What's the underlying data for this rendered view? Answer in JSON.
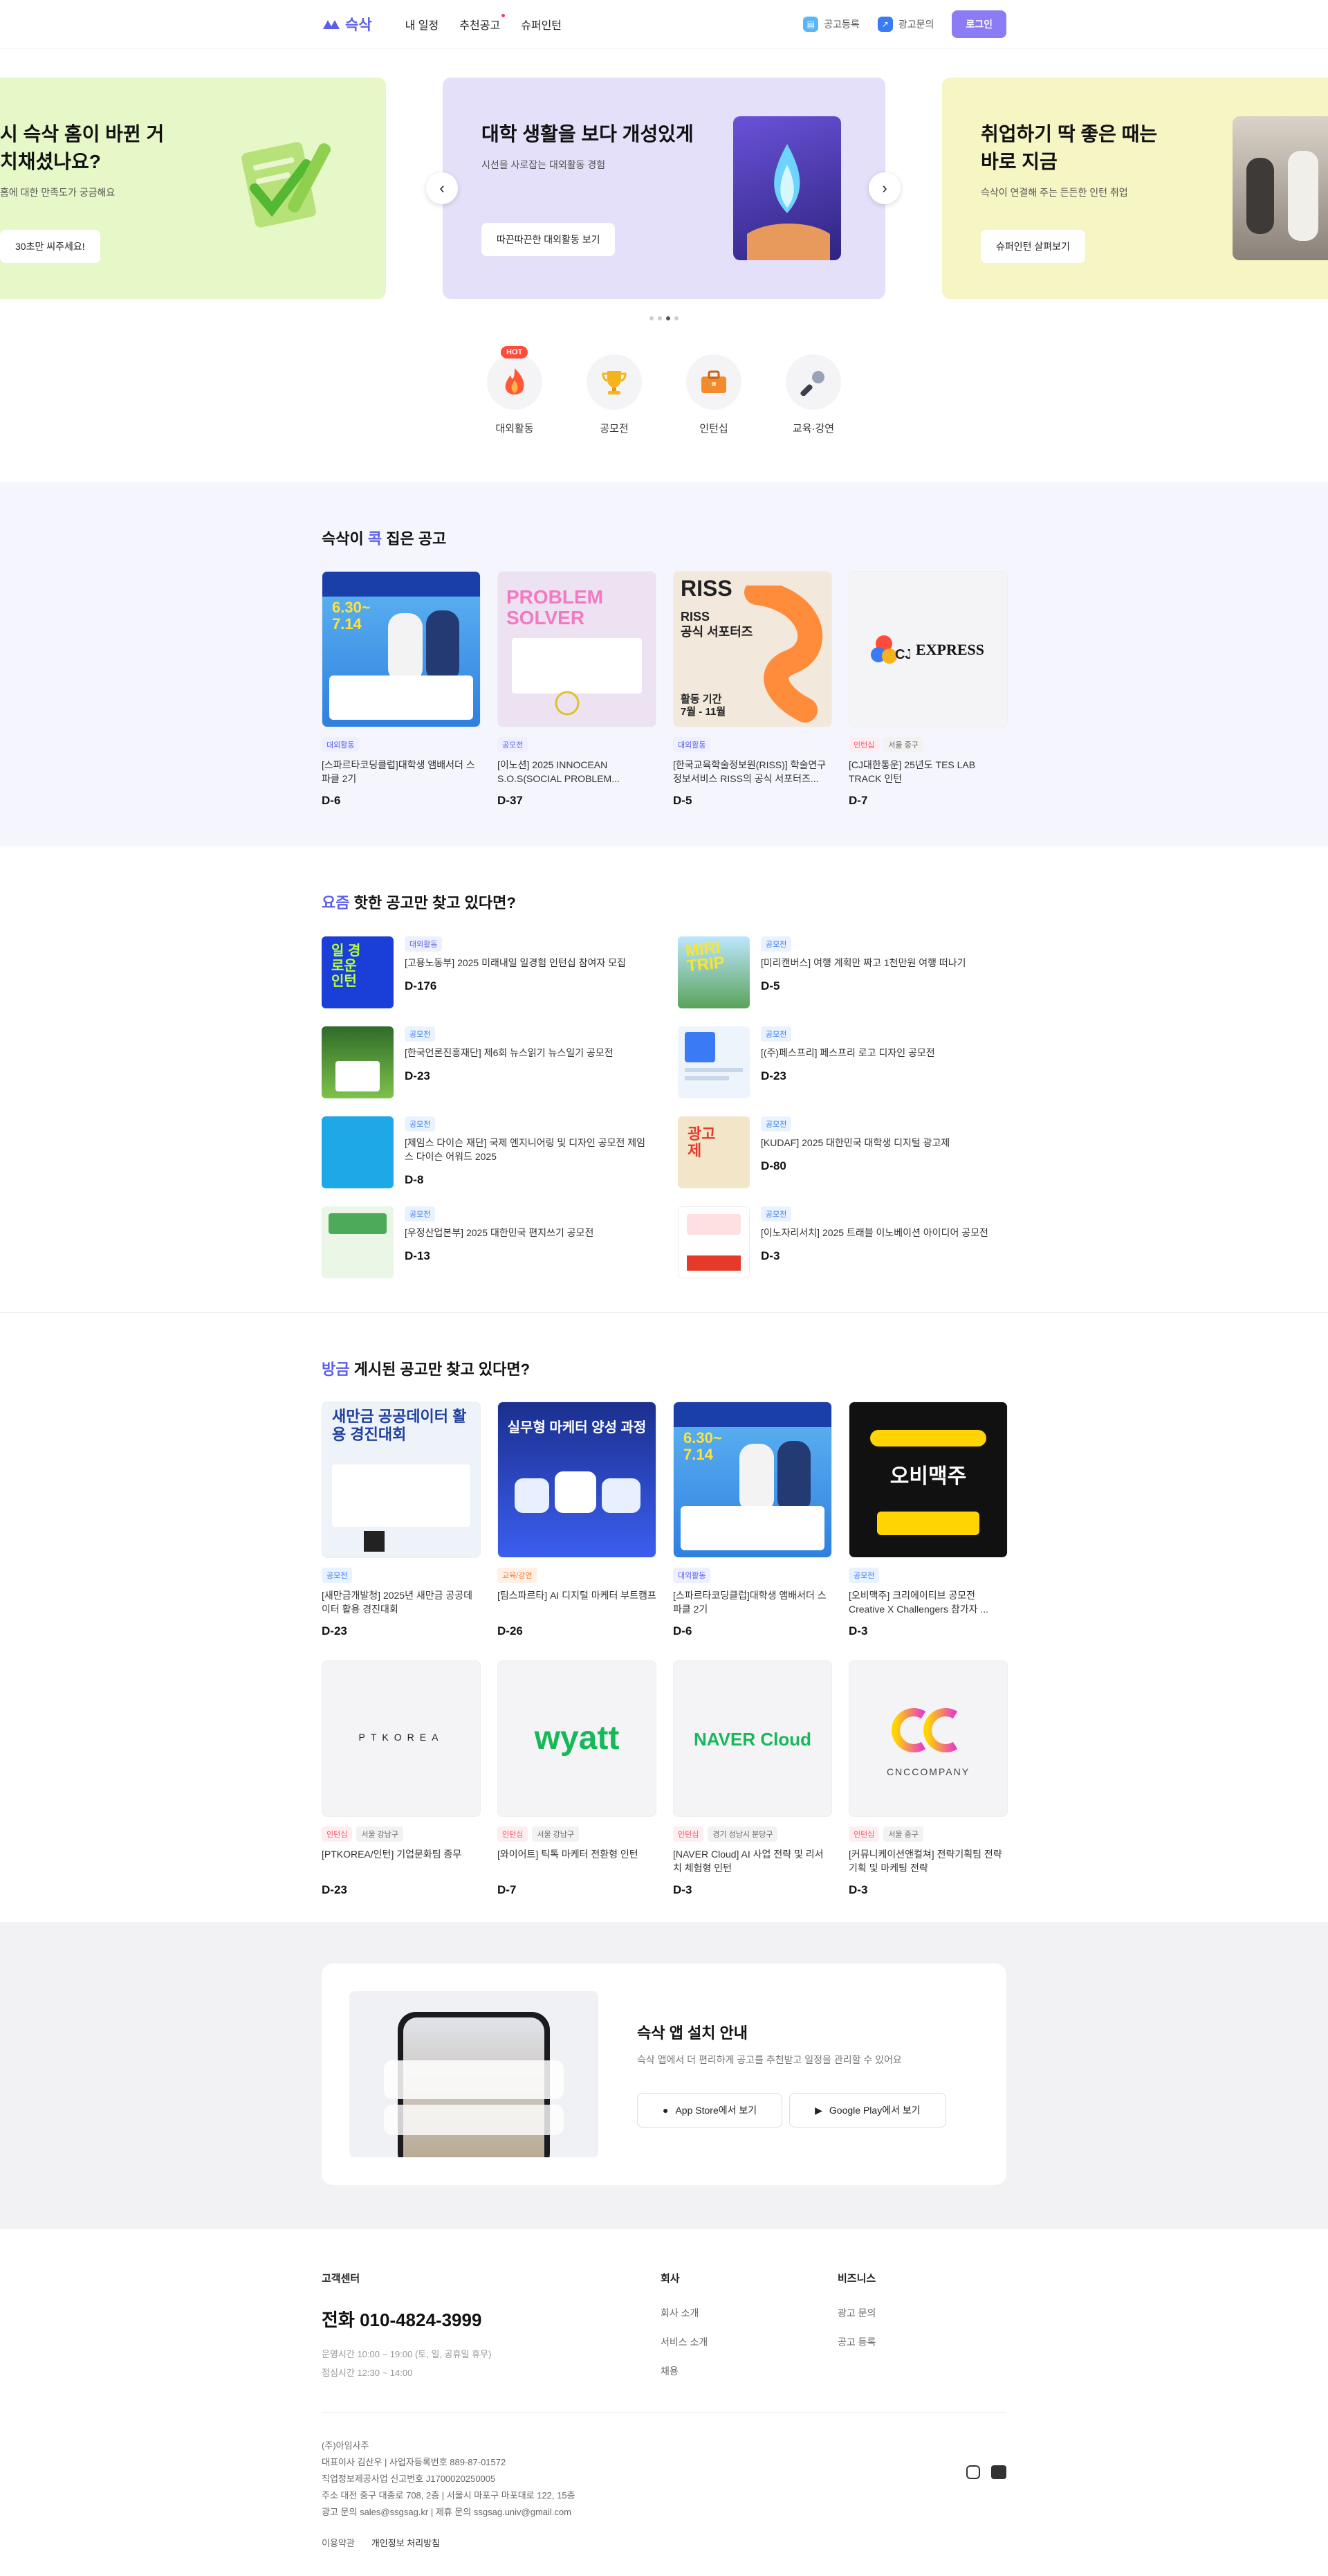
{
  "header": {
    "logo_text": "슥삭",
    "nav": [
      "내 일정",
      "추천공고",
      "슈퍼인턴"
    ],
    "ad_register": "공고등록",
    "ad_inquiry": "광고문의",
    "login": "로그인"
  },
  "hero": {
    "slides": [
      {
        "title_line1": "시 슥삭 홈이 바뀐 거",
        "title_line2": "치채셨나요?",
        "desc": "홈에 대한 만족도가 궁금해요",
        "cta": "30초만 씨주세요!",
        "bg": "#e6f8c8"
      },
      {
        "title_line1": "대학 생활을 보다 개성있게",
        "title_line2": "",
        "desc": "시선을 사로잡는 대외활동 경험",
        "cta": "따끈따끈한 대외활동 보기",
        "bg": "#e4e0fa"
      },
      {
        "title_line1": "취업하기 딱 좋은 때는",
        "title_line2": "바로 지금",
        "desc": "슥삭이 연결해 주는 든든한 인턴 취업",
        "cta": "슈퍼인턴 살펴보기",
        "bg": "#f6f5c4"
      }
    ],
    "active_dot": 2,
    "dot_count": 4
  },
  "categories": [
    {
      "label": "대외활동",
      "icon": "fire-icon",
      "badge": "HOT"
    },
    {
      "label": "공모전",
      "icon": "trophy-icon",
      "badge": ""
    },
    {
      "label": "인턴십",
      "icon": "briefcase-icon",
      "badge": ""
    },
    {
      "label": "교육·강연",
      "icon": "microphone-icon",
      "badge": ""
    }
  ],
  "pick": {
    "title_pre": "슥삭이 ",
    "title_em": "콕",
    "title_post": " 집은 공고",
    "items": [
      {
        "tags": [
          "대외활동"
        ],
        "title": "[스파르타코딩클럽]대학생 앰배서더 스파클 2기",
        "dday": "D-6"
      },
      {
        "tags": [
          "공모전"
        ],
        "title": "[이노션] 2025 INNOCEAN S.O.S(SOCIAL PROBLEM...",
        "dday": "D-37"
      },
      {
        "tags": [
          "대외활동"
        ],
        "title": "[한국교육학술정보원(RISS)] 학술연구정보서비스 RISS의 공식 서포터즈...",
        "dday": "D-5"
      },
      {
        "tags": [
          "인턴십",
          "서울 중구"
        ],
        "title": "[CJ대한통운] 25년도 TES LAB TRACK 인턴",
        "dday": "D-7"
      }
    ]
  },
  "hot": {
    "title_em": "요즘",
    "title_post": " 핫한 공고만 찾고 있다면?",
    "items": [
      {
        "tag": "대외활동",
        "title": "[고용노동부] 2025 미래내일 일경험 인턴십 참여자 모집",
        "dday": "D-176"
      },
      {
        "tag": "공모전",
        "title": "[미리캔버스] 여행 계획만 짜고 1천만원 여행 떠나기",
        "dday": "D-5"
      },
      {
        "tag": "공모전",
        "title": "[한국언론진흥재단] 제6회 뉴스읽기 뉴스일기 공모전",
        "dday": "D-23"
      },
      {
        "tag": "공모전",
        "title": "[(주)페스프리] 페스프리 로고 디자인 공모전",
        "dday": "D-23"
      },
      {
        "tag": "공모전",
        "title": "[제임스 다이슨 재단] 국제 엔지니어링 및 디자인 공모전 제임스 다이슨 어워드 2025",
        "dday": "D-8"
      },
      {
        "tag": "공모전",
        "title": "[KUDAF] 2025 대한민국 대학생 디지털 광고제",
        "dday": "D-80"
      },
      {
        "tag": "공모전",
        "title": "[우정산업본부] 2025 대한민국 편지쓰기 공모전",
        "dday": "D-13"
      },
      {
        "tag": "공모전",
        "title": "[이노자리서치] 2025 트래블 이노베이션 아이디어 공모전",
        "dday": "D-3"
      }
    ]
  },
  "new": {
    "title_em": "방금",
    "title_post": " 게시된 공고만 찾고 있다면?",
    "items": [
      {
        "tags": [
          "공모전"
        ],
        "title": "[새만금개발청] 2025년 새만금 공공데이터 활용 경진대회",
        "dday": "D-23",
        "thumb_text": "새만금 공공데이터 활용 경진대회"
      },
      {
        "tags": [
          "교육/강연"
        ],
        "title": "[팀스파르타] AI 디지털 마케터 부트캠프",
        "dday": "D-26",
        "thumb_text": "실무형 마케터 양성 과정"
      },
      {
        "tags": [
          "대외활동"
        ],
        "title": "[스파르타코딩클럽]대학생 앰배서더 스파클 2기",
        "dday": "D-6",
        "thumb_text": ""
      },
      {
        "tags": [
          "공모전"
        ],
        "title": "[오비맥주] 크리에이티브 공모전 Creative X Challengers 참가자 ...",
        "dday": "D-3",
        "thumb_text": "오비맥주"
      },
      {
        "tags": [
          "인턴십",
          "서울 강남구"
        ],
        "title": "[PTKOREA/인턴] 기업문화팀 종무",
        "dday": "D-23",
        "thumb_text": "PTKOREA"
      },
      {
        "tags": [
          "인턴십",
          "서울 강남구"
        ],
        "title": "[와이어트] 틱톡 마케터 전환형 인턴",
        "dday": "D-7",
        "thumb_text": "wyatt"
      },
      {
        "tags": [
          "인턴십",
          "경기 성남시 분당구"
        ],
        "title": "[NAVER Cloud] AI 사업 전략 및 리서치 체험형 인턴",
        "dday": "D-3",
        "thumb_text": "NAVER Cloud"
      },
      {
        "tags": [
          "인턴십",
          "서울 중구"
        ],
        "title": "[커뮤니케이션앤컬쳐] 전략기획팀 전략기획 및 마케팅 전략",
        "dday": "D-3",
        "thumb_text": "CNCCOMPANY"
      }
    ]
  },
  "app": {
    "title": "슥삭 앱 설치 안내",
    "desc": "슥삭 앱에서 더 편리하게 공고를 추천받고 일정을 관리할 수 있어요",
    "appstore": "App Store에서 보기",
    "playstore": "Google Play에서 보기"
  },
  "footer": {
    "cs_title": "고객센터",
    "tel": "전화 010-4824-3999",
    "hours": "운영시간 10:00 ~ 19:00 (토, 일, 공휴일 휴무)",
    "lunch": "점심시간 12:30 ~ 14:00",
    "company_title": "회사",
    "company_links": [
      "회사 소개",
      "서비스 소개",
      "채용"
    ],
    "biz_title": "비즈니스",
    "biz_links": [
      "광고 문의",
      "공고 등록"
    ],
    "corp": "(주)아임사주",
    "info1": "대표이사 김산우 | 사업자등록번호 889-87-01572",
    "info2": "직업정보제공사업 신고번호 J1700020250005",
    "info3": "주소 대전 중구 대종로 708, 2층 | 서울시 마포구 마포대로 122, 15층",
    "info4": "광고 문의 sales@ssgsag.kr | 제휴 문의 ssgsag.univ@gmail.com",
    "terms": "이용약관",
    "privacy": "개인정보 처리방침"
  }
}
